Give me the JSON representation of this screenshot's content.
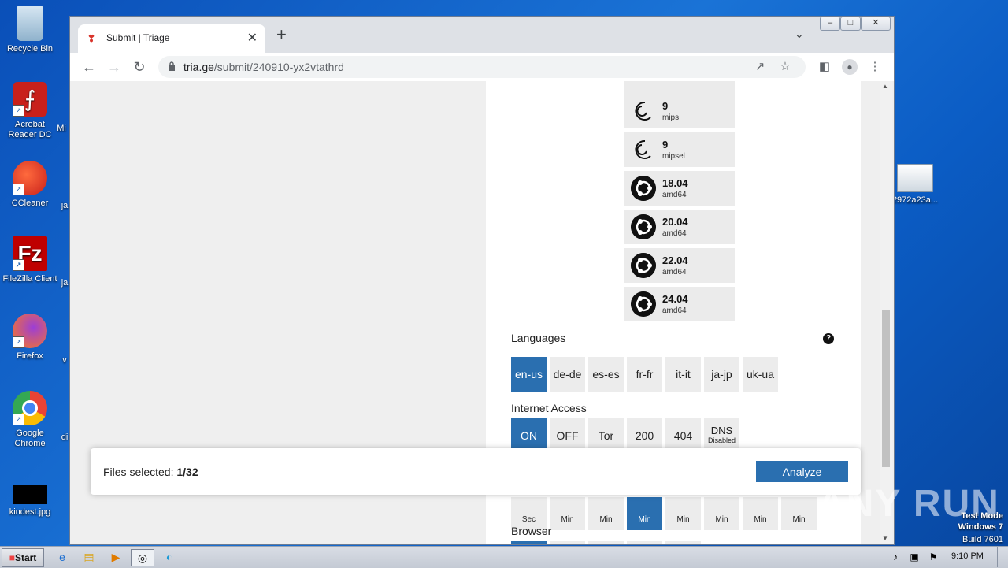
{
  "desktop": {
    "icons": [
      {
        "label": "Recycle Bin"
      },
      {
        "label": "Acrobat Reader DC"
      },
      {
        "label": "CCleaner"
      },
      {
        "label": "FileZilla Client"
      },
      {
        "label": "Firefox"
      },
      {
        "label": "Google Chrome"
      },
      {
        "label": "kindest.jpg"
      },
      {
        "label": "2972a23a..."
      }
    ],
    "partial_labels": [
      "Mi",
      "ja",
      "ja",
      "v",
      "di"
    ]
  },
  "browser": {
    "tab_title": "Submit | Triage",
    "url_host": "tria.ge",
    "url_path": "/submit/240910-yx2vtathrd",
    "window_controls": [
      "–",
      "□",
      "✕"
    ]
  },
  "os_list": [
    {
      "version": "9",
      "arch": "mips",
      "icon": "debian-icon"
    },
    {
      "version": "9",
      "arch": "mipsel",
      "icon": "debian-icon"
    },
    {
      "version": "18.04",
      "arch": "amd64",
      "icon": "ubuntu-icon"
    },
    {
      "version": "20.04",
      "arch": "amd64",
      "icon": "ubuntu-icon"
    },
    {
      "version": "22.04",
      "arch": "amd64",
      "icon": "ubuntu-icon"
    },
    {
      "version": "24.04",
      "arch": "amd64",
      "icon": "ubuntu-icon"
    }
  ],
  "languages": {
    "label": "Languages",
    "help": "?",
    "options": [
      "en-us",
      "de-de",
      "es-es",
      "fr-fr",
      "it-it",
      "ja-jp",
      "uk-ua"
    ],
    "selected": "en-us"
  },
  "internet": {
    "label": "Internet Access",
    "options": [
      "ON",
      "OFF",
      "Tor",
      "200",
      "404",
      "DNS"
    ],
    "dns_sub": "Disabled",
    "selected": "ON"
  },
  "timeout": {
    "units": [
      "Sec",
      "Min",
      "Min",
      "Min",
      "Min",
      "Min",
      "Min",
      "Min"
    ],
    "selected_index": 3
  },
  "browser_section": {
    "label": "Browser"
  },
  "modal": {
    "files_label": "Files selected: ",
    "files_value": "1/32",
    "analyze": "Analyze"
  },
  "taskbar": {
    "start": "Start",
    "time": "9:10 PM"
  },
  "watermark": {
    "brand": "ANY RUN",
    "line1": "Test Mode",
    "line2": "Windows 7",
    "line3": "Build 7601"
  },
  "colors": {
    "accent": "#2a6fb0",
    "chip": "#ececec"
  }
}
